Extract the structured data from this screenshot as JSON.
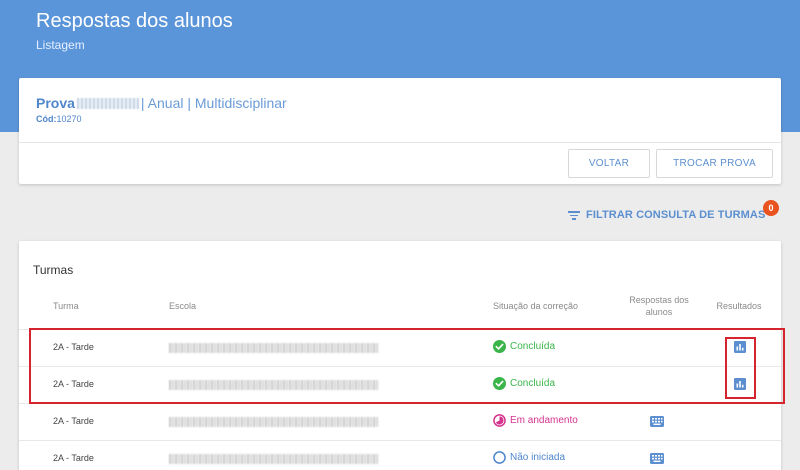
{
  "header": {
    "title": "Respostas dos alunos",
    "subtitle": "Listagem"
  },
  "exam": {
    "prefix": "Prova",
    "suffix": "| Anual | Multidisciplinar",
    "code_label": "Cód:",
    "code_value": "10270"
  },
  "buttons": {
    "back": "VOLTAR",
    "swap": "TROCAR PROVA"
  },
  "filter": {
    "label": "FILTRAR CONSULTA DE TURMAS",
    "badge": "0"
  },
  "classes": {
    "title": "Turmas",
    "columns": {
      "turma": "Turma",
      "escola": "Escola",
      "situacao": "Situação da correção",
      "respostas": "Respostas dos alunos",
      "resultados": "Resultados"
    },
    "rows": [
      {
        "turma": "2A - Tarde",
        "status": "Concluída",
        "status_type": "done",
        "has_answers": false,
        "has_results": true
      },
      {
        "turma": "2A - Tarde",
        "status": "Concluída",
        "status_type": "done",
        "has_answers": false,
        "has_results": true
      },
      {
        "turma": "2A - Tarde",
        "status": "Em andamento",
        "status_type": "progress",
        "has_answers": true,
        "has_results": false
      },
      {
        "turma": "2A - Tarde",
        "status": "Não iniciada",
        "status_type": "pending",
        "has_answers": true,
        "has_results": false
      }
    ]
  },
  "colors": {
    "header_blue": "#5b95d9",
    "accent_blue": "#5b8fd0",
    "done_green": "#3bb54a",
    "progress_pink": "#d6338f",
    "pending_blue": "#4f86cc",
    "badge_orange": "#e8531f",
    "highlight_red": "#d6242f"
  }
}
